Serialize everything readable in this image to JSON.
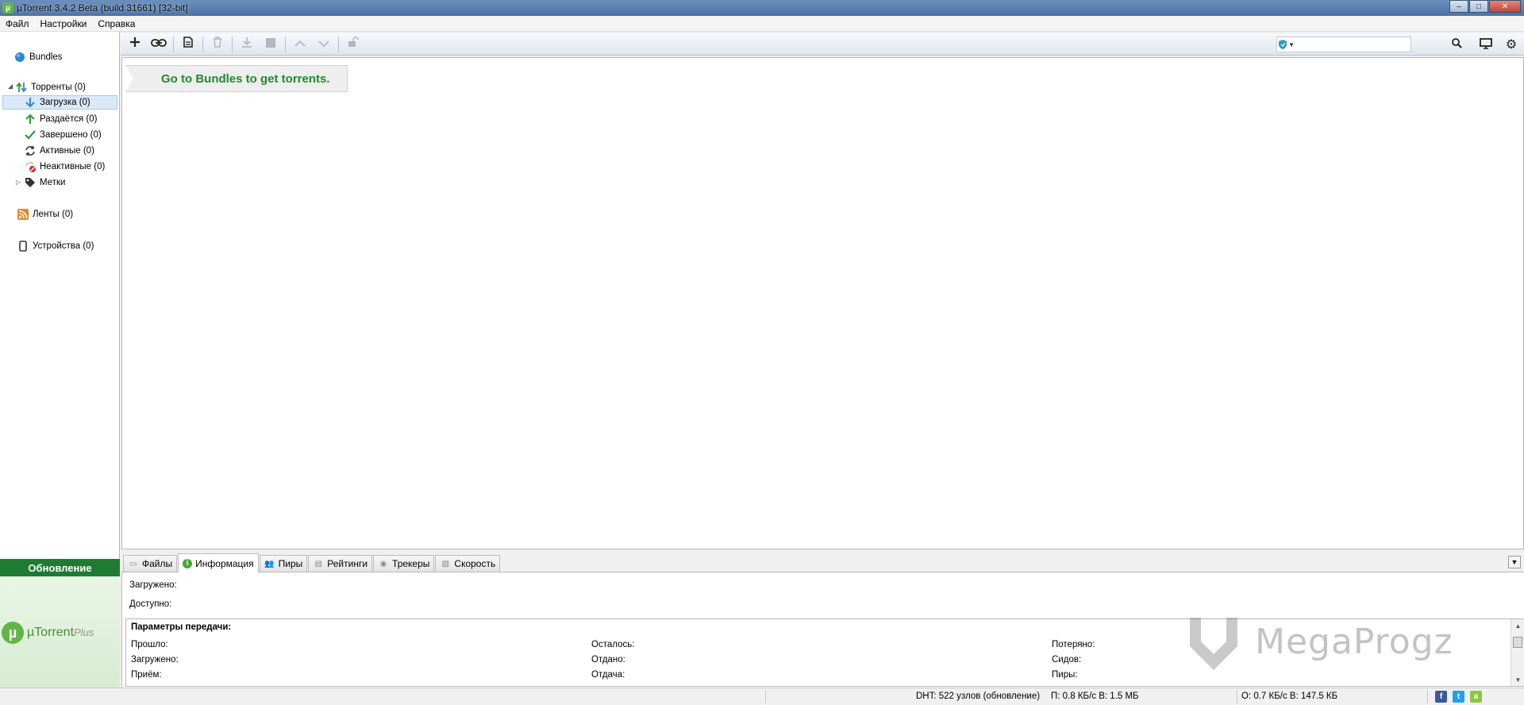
{
  "window": {
    "title": "µTorrent 3.4.2 Beta (build 31661) [32-bit]",
    "minimize": "–",
    "maximize": "□",
    "close": "✕"
  },
  "menu": [
    "Файл",
    "Настройки",
    "Справка"
  ],
  "sidebar": {
    "bundles": "Bundles",
    "torrents": "Торренты (0)",
    "items": [
      {
        "label": "Загрузка (0)",
        "icon": "download-arrow-icon",
        "selected": true
      },
      {
        "label": "Раздаётся (0)",
        "icon": "upload-arrow-icon"
      },
      {
        "label": "Завершено (0)",
        "icon": "checkmark-icon"
      },
      {
        "label": "Активные (0)",
        "icon": "refresh-icon"
      },
      {
        "label": "Неактивные (0)",
        "icon": "inactive-icon"
      },
      {
        "label": "Метки",
        "icon": "tag-icon"
      }
    ],
    "feeds": "Ленты (0)",
    "devices": "Устройства (0)"
  },
  "update_label": "Обновление",
  "plus_logo": {
    "brand": "µTorrent",
    "suffix": "Plus"
  },
  "search": {
    "placeholder": ""
  },
  "banner": "Go to Bundles to get torrents.",
  "tabs": [
    {
      "label": "Файлы",
      "icon": "folder-icon"
    },
    {
      "label": "Информация",
      "icon": "info-icon",
      "active": true
    },
    {
      "label": "Пиры",
      "icon": "peers-icon"
    },
    {
      "label": "Рейтинги",
      "icon": "ratings-icon"
    },
    {
      "label": "Трекеры",
      "icon": "trackers-icon"
    },
    {
      "label": "Скорость",
      "icon": "speed-icon"
    }
  ],
  "info": {
    "downloaded": "Загружено:",
    "available": "Доступно:",
    "params_title": "Параметры передачи:",
    "col1": [
      "Прошло:",
      "Загружено:",
      "Приём:"
    ],
    "col2": [
      "Осталось:",
      "Отдано:",
      "Отдача:"
    ],
    "col3": [
      "Потеряно:",
      "Сидов:",
      "Пиры:"
    ]
  },
  "watermark": "MegaProgz",
  "status": {
    "dht": "DHT: 522 узлов  (обновление)",
    "down": "П: 0.8 КБ/с В: 1.5 МБ",
    "up": "О: 0.7 КБ/с В: 147.5 КБ"
  },
  "colors": {
    "accent_green": "#1f8a2c",
    "update_bar": "#1e7c32",
    "brand_green": "#62b548"
  }
}
